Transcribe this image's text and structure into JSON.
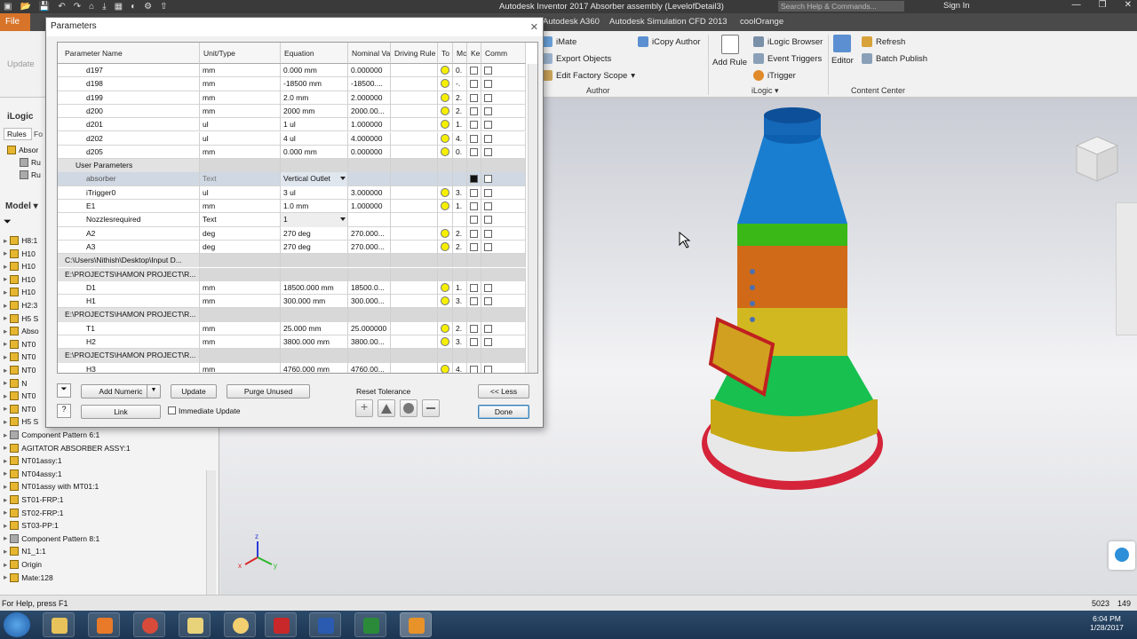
{
  "titlebar": {
    "quick_access": [
      "▣",
      "📂",
      "💾",
      "↶",
      "↷",
      "⌂",
      "⤓",
      "▦",
      "◐",
      "⚙",
      "⇧"
    ],
    "title": "Autodesk Inventor 2017    Absorber assembly (LevelofDetail3)",
    "search_placeholder": "Search Help & Commands...",
    "signin": "Sign In",
    "window_controls": [
      "—",
      "❐",
      "✕"
    ]
  },
  "tabs": {
    "file": "File",
    "tabs": [
      "Autodesk A360",
      "Autodesk Simulation CFD 2013",
      "coolOrange"
    ]
  },
  "ribbon": {
    "update": "Update",
    "author_items": [
      "iMate",
      "Export Objects",
      "Edit Factory Scope"
    ],
    "icopy": "iCopy Author",
    "author_group": "Author",
    "add_rule": "Add Rule",
    "ilogic_items": [
      "iLogic Browser",
      "Event Triggers",
      "iTrigger"
    ],
    "ilogic_group": "iLogic",
    "editor": "Editor",
    "content_items": [
      "Refresh",
      "Batch Publish"
    ],
    "content_group": "Content Center"
  },
  "left_panel": {
    "ilogic_label": "iLogic",
    "rules_tab": "Rules",
    "forms_tab": "Fo",
    "rule_items": [
      "Absor",
      "Ru",
      "Ru"
    ],
    "model_label": "Model",
    "tree": [
      "H8:1",
      "H10",
      "H10",
      "H10",
      "H10",
      "H2:3",
      "H5 S",
      "Abso",
      "NT0",
      "NT0",
      "NT0",
      "N",
      "NT0",
      "NT0",
      "H5 S",
      "Component Pattern 6:1",
      "AGITATOR  ABSORBER ASSY:1",
      "NT01assy:1",
      "NT04assy:1",
      "NT01assy with MT01:1",
      "ST01-FRP:1",
      "ST02-FRP:1",
      "ST03-PP:1",
      "Component Pattern 8:1",
      "N1_1:1",
      "Origin",
      "Mate:128"
    ]
  },
  "dialog": {
    "title": "Parameters",
    "columns": [
      "Parameter Name",
      "Unit/Type",
      "Equation",
      "Nominal Va",
      "Driving Rule",
      "To",
      "Mc",
      "Ke",
      "Comm"
    ],
    "rows": [
      {
        "type": "param",
        "name": "d197",
        "unit": "mm",
        "eq": "0.000 mm",
        "nom": "0.000000",
        "to": "0.",
        "dot": true
      },
      {
        "type": "param",
        "name": "d198",
        "unit": "mm",
        "eq": "-18500 mm",
        "nom": "-18500....",
        "to": "-.",
        "dot": true
      },
      {
        "type": "param",
        "name": "d199",
        "unit": "mm",
        "eq": "2.0 mm",
        "nom": "2.000000",
        "to": "2.",
        "dot": true
      },
      {
        "type": "param",
        "name": "d200",
        "unit": "mm",
        "eq": "2000 mm",
        "nom": "2000.00...",
        "to": "2.",
        "dot": true
      },
      {
        "type": "param",
        "name": "d201",
        "unit": "ul",
        "eq": "1 ul",
        "nom": "1.000000",
        "to": "1.",
        "dot": true
      },
      {
        "type": "param",
        "name": "d202",
        "unit": "ul",
        "eq": "4 ul",
        "nom": "4.000000",
        "to": "4.",
        "dot": true
      },
      {
        "type": "param",
        "name": "d205",
        "unit": "mm",
        "eq": "0.000 mm",
        "nom": "0.000000",
        "to": "0.",
        "dot": true
      },
      {
        "type": "group",
        "name": "User Parameters"
      },
      {
        "type": "param",
        "name": "absorber",
        "unit": "Text",
        "eq": "Vertical Outlet",
        "nom": "",
        "to": "",
        "dot": false,
        "sel": true,
        "dropdown": true,
        "keychecked": true
      },
      {
        "type": "param",
        "name": "iTrigger0",
        "unit": "ul",
        "eq": "3 ul",
        "nom": "3.000000",
        "to": "3.",
        "dot": true
      },
      {
        "type": "param",
        "name": "E1",
        "unit": "mm",
        "eq": "1.0 mm",
        "nom": "1.000000",
        "to": "1.",
        "dot": true
      },
      {
        "type": "param",
        "name": "Nozzlesrequired",
        "unit": "Text",
        "eq": "1",
        "nom": "",
        "to": "",
        "dot": false,
        "dropdown": true
      },
      {
        "type": "param",
        "name": "A2",
        "unit": "deg",
        "eq": "270 deg",
        "nom": "270.000...",
        "to": "2.",
        "dot": true
      },
      {
        "type": "param",
        "name": "A3",
        "unit": "deg",
        "eq": "270 deg",
        "nom": "270.000...",
        "to": "2.",
        "dot": true
      },
      {
        "type": "group",
        "name": "C:\\Users\\Nithish\\Desktop\\Input D..."
      },
      {
        "type": "group",
        "name": "E:\\PROJECTS\\HAMON PROJECT\\R..."
      },
      {
        "type": "param",
        "name": "D1",
        "unit": "mm",
        "eq": "18500.000 mm",
        "nom": "18500.0...",
        "to": "1.",
        "dot": true
      },
      {
        "type": "param",
        "name": "H1",
        "unit": "mm",
        "eq": "300.000 mm",
        "nom": "300.000...",
        "to": "3.",
        "dot": true
      },
      {
        "type": "group",
        "name": "E:\\PROJECTS\\HAMON PROJECT\\R..."
      },
      {
        "type": "param",
        "name": "T1",
        "unit": "mm",
        "eq": "25.000 mm",
        "nom": "25.000000",
        "to": "2.",
        "dot": true
      },
      {
        "type": "param",
        "name": "H2",
        "unit": "mm",
        "eq": "3800.000 mm",
        "nom": "3800.00...",
        "to": "3.",
        "dot": true
      },
      {
        "type": "group",
        "name": "E:\\PROJECTS\\HAMON PROJECT\\R..."
      },
      {
        "type": "param",
        "name": "H3",
        "unit": "mm",
        "eq": "4760.000 mm",
        "nom": "4760.00...",
        "to": "4.",
        "dot": true
      }
    ],
    "buttons": {
      "add_numeric": "Add Numeric",
      "update": "Update",
      "purge": "Purge Unused",
      "less": "<< Less",
      "link": "Link",
      "done": "Done"
    },
    "immediate_update": "Immediate Update",
    "reset_tolerance": "Reset Tolerance"
  },
  "status": {
    "help": "For Help, press F1",
    "n1": "5023",
    "n2": "149"
  },
  "taskbar": {
    "time": "6:04 PM",
    "date": "1/28/2017"
  },
  "colors": {
    "accent": "#d7742a",
    "selection": "#cfd8e3"
  },
  "viewport": {
    "axis_labels": [
      "z",
      "x",
      "y"
    ]
  }
}
